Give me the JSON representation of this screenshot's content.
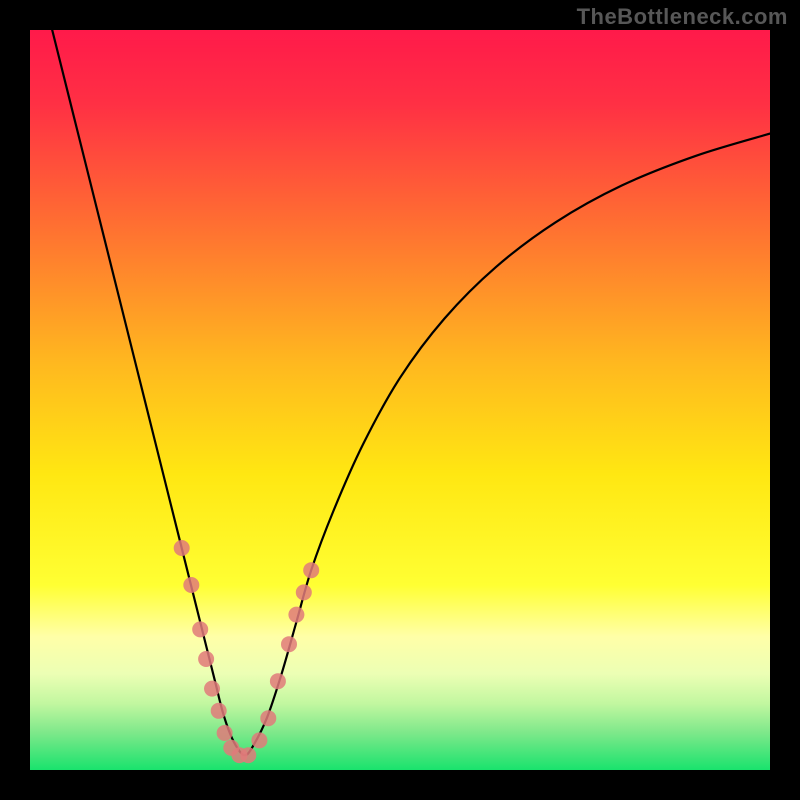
{
  "watermark": "TheBottleneck.com",
  "chart_data": {
    "type": "line",
    "title": "",
    "xlabel": "",
    "ylabel": "",
    "xlim": [
      0,
      100
    ],
    "ylim": [
      0,
      100
    ],
    "background_gradient": {
      "stops": [
        {
          "offset": 0.0,
          "color": "#ff1a4a"
        },
        {
          "offset": 0.1,
          "color": "#ff3044"
        },
        {
          "offset": 0.25,
          "color": "#ff6a33"
        },
        {
          "offset": 0.45,
          "color": "#ffb81f"
        },
        {
          "offset": 0.6,
          "color": "#ffe712"
        },
        {
          "offset": 0.75,
          "color": "#ffff33"
        },
        {
          "offset": 0.82,
          "color": "#ffffa8"
        },
        {
          "offset": 0.87,
          "color": "#ecffb4"
        },
        {
          "offset": 0.91,
          "color": "#c2f7a0"
        },
        {
          "offset": 0.95,
          "color": "#7de88a"
        },
        {
          "offset": 1.0,
          "color": "#19e36d"
        }
      ]
    },
    "series": [
      {
        "name": "curve",
        "color": "#000000",
        "stroke_width": 2.2,
        "x": [
          3,
          5,
          7,
          9,
          11,
          13,
          15,
          17,
          19,
          21,
          23,
          25,
          26,
          27,
          28,
          29,
          30,
          32,
          34,
          36,
          38,
          41,
          45,
          50,
          56,
          63,
          71,
          80,
          90,
          100
        ],
        "y": [
          100,
          92,
          84,
          76,
          68,
          60,
          52,
          44,
          36,
          28,
          20,
          12,
          8,
          5,
          3,
          2,
          3,
          7,
          13,
          20,
          27,
          35,
          44,
          53,
          61,
          68,
          74,
          79,
          83,
          86
        ]
      }
    ],
    "scatter": {
      "name": "markers",
      "color": "#e07a7a",
      "radius": 8,
      "x": [
        20.5,
        21.8,
        23.0,
        23.8,
        24.6,
        25.5,
        26.3,
        27.2,
        28.3,
        29.5,
        31.0,
        32.2,
        33.5,
        35.0,
        36.0,
        37.0,
        38.0
      ],
      "y": [
        30,
        25,
        19,
        15,
        11,
        8,
        5,
        3,
        2,
        2,
        4,
        7,
        12,
        17,
        21,
        24,
        27
      ]
    }
  }
}
